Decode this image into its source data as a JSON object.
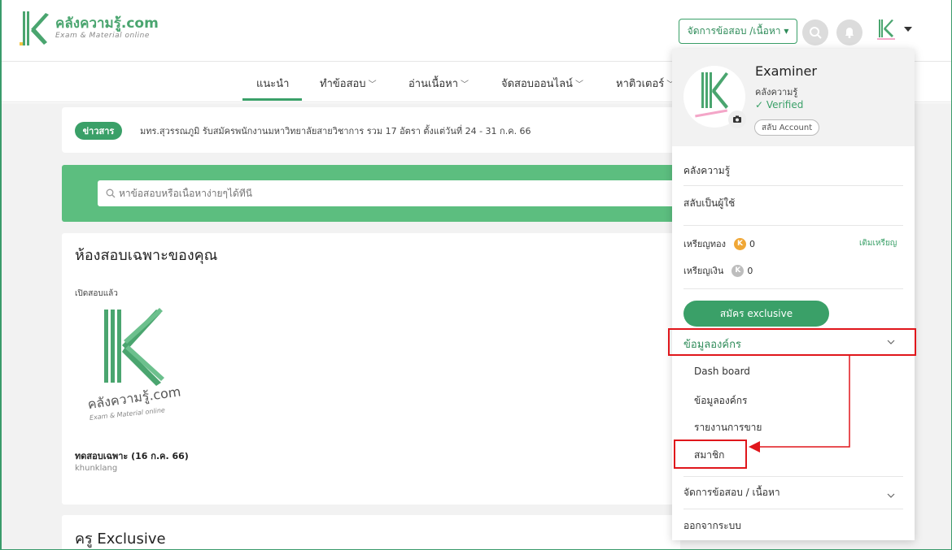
{
  "header": {
    "logo_title": "คลังความรู้.com",
    "logo_subtitle": "Exam & Material online",
    "manage_button": "จัดการข้อสอบ /เนื้อหา ▾",
    "search_icon": "search-icon",
    "bell_icon": "bell-icon"
  },
  "nav": {
    "items": [
      {
        "label": "แนะนำ"
      },
      {
        "label": "ทำข้อสอบ"
      },
      {
        "label": "อ่านเนื้อหา"
      },
      {
        "label": "จัดสอบออนไลน์"
      },
      {
        "label": "หาติวเตอร์"
      }
    ]
  },
  "news": {
    "badge": "ข่าวสาร",
    "text": "มทร.สุวรรณภูมิ รับสมัครพนักงานมหาวิทยาลัยสายวิชาการ รวม 17 อัตรา ตั้งแต่วันที่ 24 - 31 ก.ค. 66"
  },
  "search": {
    "placeholder": "หาข้อสอบหรือเนื้อหาง่ายๆได้ที่นี่"
  },
  "room": {
    "title": "ห้องสอบเฉพาะของคุณ",
    "status": "เปิดสอบแล้ว",
    "exam_name": "ทดสอบเฉพาะ (16 ก.ค. 66)",
    "owner": "khunklang",
    "image_text": "คลังความรู้.com",
    "image_sub": "Exam & Material online"
  },
  "teacher": {
    "title": "ครู Exclusive"
  },
  "dropdown": {
    "name": "Examiner",
    "org": "คลังความรู้",
    "verified": "✓ Verified",
    "switch_account": "สลับ Account",
    "item_klang": "คลังความรู้",
    "item_switch_user": "สลับเป็นผู้ใช้",
    "gold_label": "เหรียญทอง",
    "gold_value": "0",
    "silver_label": "เหรียญเงิน",
    "silver_value": "0",
    "topup": "เติมเหรียญ",
    "exclusive_button": "สมัคร exclusive",
    "org_section": "ข้อมูลองค์กร",
    "sub_items": [
      {
        "label": "Dash board"
      },
      {
        "label": "ข้อมูลองค์กร"
      },
      {
        "label": "รายงานการขาย"
      },
      {
        "label": "สมาชิก"
      }
    ],
    "manage": "จัดการข้อสอบ / เนื้อหา",
    "logout": "ออกจากระบบ"
  },
  "colors": {
    "brand_green": "#3aa068",
    "highlight_red": "#e0161b"
  }
}
